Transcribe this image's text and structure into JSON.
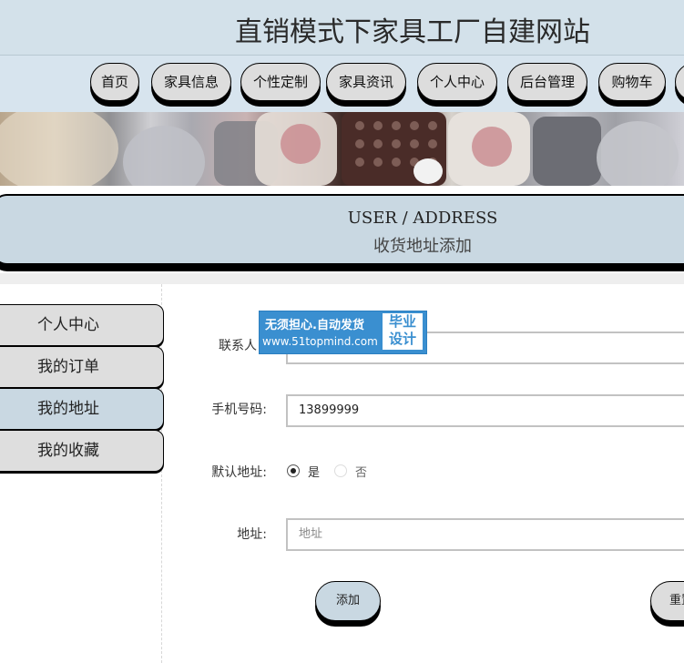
{
  "header": {
    "title": "直销模式下家具工厂自建网站"
  },
  "nav": {
    "items": [
      {
        "label": "首页"
      },
      {
        "label": "家具信息"
      },
      {
        "label": "个性定制"
      },
      {
        "label": "家具资讯"
      },
      {
        "label": "个人中心"
      },
      {
        "label": "后台管理"
      },
      {
        "label": "购物车"
      }
    ]
  },
  "page_title": {
    "en": "USER / ADDRESS",
    "cn": "收货地址添加"
  },
  "sidebar": {
    "items": [
      {
        "label": "个人中心"
      },
      {
        "label": "我的订单"
      },
      {
        "label": "我的地址",
        "active": true
      },
      {
        "label": "我的收藏"
      }
    ]
  },
  "form": {
    "contact_label": "联系人",
    "phone_label": "手机号码:",
    "phone_value": "13899999",
    "default_label": "默认地址:",
    "default_yes": "是",
    "default_no": "否",
    "address_label": "地址:",
    "address_placeholder": "地址",
    "add_button": "添加",
    "reset_button": "重置"
  },
  "watermark": {
    "line1": "无须担心.自动发货",
    "line2": "www.51topmind.com",
    "badge": "毕业设计"
  },
  "colors": {
    "accent": "#c9d8e2",
    "header_bg": "#d3e1ea",
    "watermark_blue": "#3a8fd0"
  }
}
